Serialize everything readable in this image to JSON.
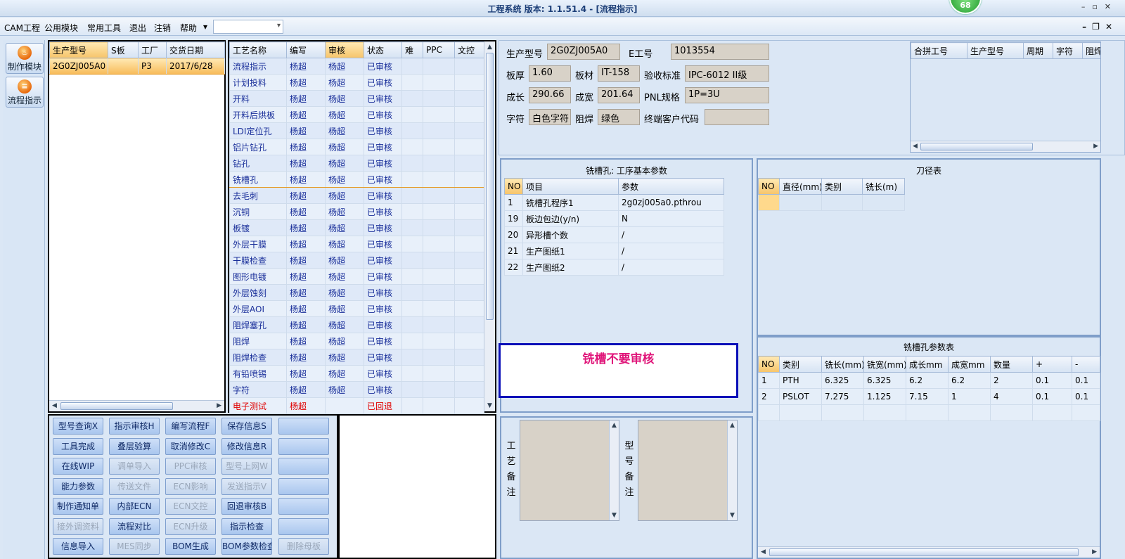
{
  "window": {
    "title": "工程系统  版本: 1.1.51.4 - [流程指示]",
    "badge": "68"
  },
  "menu": {
    "items": [
      "CAM工程",
      "公用模块",
      "常用工具",
      "退出",
      "注销",
      "帮助"
    ],
    "dropdown_arrow": "▾",
    "combo_value": ""
  },
  "nav": {
    "items": [
      {
        "label": "制作模块",
        "icon": "flame-icon"
      },
      {
        "label": "流程指示",
        "icon": "list-icon"
      }
    ]
  },
  "orders": {
    "headers": [
      "生产型号",
      "S板",
      "工厂",
      "交货日期"
    ],
    "rows": [
      [
        "2G0ZJ005A0",
        "",
        "P3",
        "2017/6/28"
      ]
    ]
  },
  "process": {
    "headers": [
      "工艺名称",
      "编写",
      "审核",
      "状态",
      "难",
      "PPC",
      "文控"
    ],
    "rows": [
      [
        "流程指示",
        "杨超",
        "杨超",
        "已审核"
      ],
      [
        "计划投料",
        "杨超",
        "杨超",
        "已审核"
      ],
      [
        "开料",
        "杨超",
        "杨超",
        "已审核"
      ],
      [
        "开料后烘板",
        "杨超",
        "杨超",
        "已审核"
      ],
      [
        "LDI定位孔",
        "杨超",
        "杨超",
        "已审核"
      ],
      [
        "铝片钻孔",
        "杨超",
        "杨超",
        "已审核"
      ],
      [
        "钻孔",
        "杨超",
        "杨超",
        "已审核"
      ],
      [
        "铣槽孔",
        "杨超",
        "杨超",
        "已审核"
      ],
      [
        "去毛刺",
        "杨超",
        "杨超",
        "已审核"
      ],
      [
        "沉铜",
        "杨超",
        "杨超",
        "已审核"
      ],
      [
        "板镀",
        "杨超",
        "杨超",
        "已审核"
      ],
      [
        "外层干膜",
        "杨超",
        "杨超",
        "已审核"
      ],
      [
        "干膜检查",
        "杨超",
        "杨超",
        "已审核"
      ],
      [
        "图形电镀",
        "杨超",
        "杨超",
        "已审核"
      ],
      [
        "外层蚀刻",
        "杨超",
        "杨超",
        "已审核"
      ],
      [
        "外层AOI",
        "杨超",
        "杨超",
        "已审核"
      ],
      [
        "阻焊塞孔",
        "杨超",
        "杨超",
        "已审核"
      ],
      [
        "阻焊",
        "杨超",
        "杨超",
        "已审核"
      ],
      [
        "阻焊检查",
        "杨超",
        "杨超",
        "已审核"
      ],
      [
        "有铅喷锡",
        "杨超",
        "杨超",
        "已审核"
      ],
      [
        "字符",
        "杨超",
        "杨超",
        "已审核"
      ],
      [
        "电子测试",
        "杨超",
        "",
        "已回退"
      ]
    ],
    "selected_index": 7,
    "rejected_index": 21
  },
  "buttons": [
    [
      "型号查询X",
      "指示审核H",
      "编写流程F",
      "保存信息S",
      ""
    ],
    [
      "工具完成",
      "叠层验算",
      "取消修改C",
      "修改信息R",
      ""
    ],
    [
      "在线WIP",
      "调单导入",
      "PPC审核",
      "型号上网W",
      ""
    ],
    [
      "能力参数",
      "传送文件",
      "ECN影响",
      "发送指示V",
      ""
    ],
    [
      "制作通知单",
      "内部ECN",
      "ECN文控",
      "回退审核B",
      ""
    ],
    [
      "接外调资料",
      "流程对比",
      "ECN升级",
      "指示检查",
      ""
    ],
    [
      "信息导入",
      "MES同步",
      "BOM生成",
      "BOM参数检查",
      "删除母板"
    ]
  ],
  "buttons_disabled": [
    [
      false,
      false,
      false,
      false,
      false
    ],
    [
      false,
      false,
      false,
      false,
      false
    ],
    [
      false,
      true,
      true,
      true,
      false
    ],
    [
      false,
      true,
      true,
      true,
      false
    ],
    [
      false,
      false,
      true,
      false,
      false
    ],
    [
      true,
      false,
      true,
      false,
      false
    ],
    [
      false,
      true,
      false,
      false,
      true
    ]
  ],
  "info": {
    "model_label": "生产型号",
    "model": "2G0ZJ005A0",
    "e_label": "E工号",
    "e_no": "1013554",
    "thickness_label": "板厚",
    "thickness": "1.60",
    "material_label": "板材",
    "material": "IT-158",
    "standard_label": "验收标准",
    "standard": "IPC-6012 II级",
    "length_label": "成长",
    "length": "290.66",
    "width_label": "成宽",
    "width": "201.64",
    "pnl_label": "PNL规格",
    "pnl": "1P=3U",
    "char_label": "字符",
    "char": "白色字符",
    "mask_label": "阻焊",
    "mask": "绿色",
    "customer_label": "终端客户代码",
    "customer": ""
  },
  "combine": {
    "headers": [
      "合拼工号",
      "生产型号",
      "周期",
      "字符",
      "阻焊"
    ]
  },
  "params": {
    "title": "铣槽孔: 工序基本参数",
    "headers": [
      "NO",
      "项目",
      "参数"
    ],
    "rows": [
      [
        "1",
        "铣槽孔程序1",
        "2g0zj005a0.pthrou"
      ],
      [
        "19",
        "板边包边(y/n)",
        "N"
      ],
      [
        "20",
        "异形槽个数",
        "/"
      ],
      [
        "21",
        "生产图纸1",
        "/"
      ],
      [
        "22",
        "生产图纸2",
        "/"
      ]
    ]
  },
  "tools": {
    "title": "刀径表",
    "headers": [
      "NO",
      "直径(mm)",
      "类别",
      "铣长(m)"
    ]
  },
  "slot_params": {
    "title": "铣槽孔参数表",
    "headers": [
      "NO",
      "类别",
      "铣长(mm)",
      "铣宽(mm)",
      "成长mm",
      "成宽mm",
      "数量",
      "+",
      "-"
    ],
    "rows": [
      [
        "1",
        "PTH",
        "6.325",
        "6.325",
        "6.2",
        "6.2",
        "2",
        "0.1",
        "0.1"
      ],
      [
        "2",
        "PSLOT",
        "7.275",
        "1.125",
        "7.15",
        "1",
        "4",
        "0.1",
        "0.1"
      ]
    ]
  },
  "notice": {
    "text": "铣槽不要审核",
    "color": "#e0167a"
  },
  "memo": {
    "process_label": "工艺备注",
    "model_label": "型号备注"
  },
  "colors": {
    "selected_row": "#f7bb59",
    "rejected": "#e00000",
    "text_blue": "#1a2f9a"
  }
}
